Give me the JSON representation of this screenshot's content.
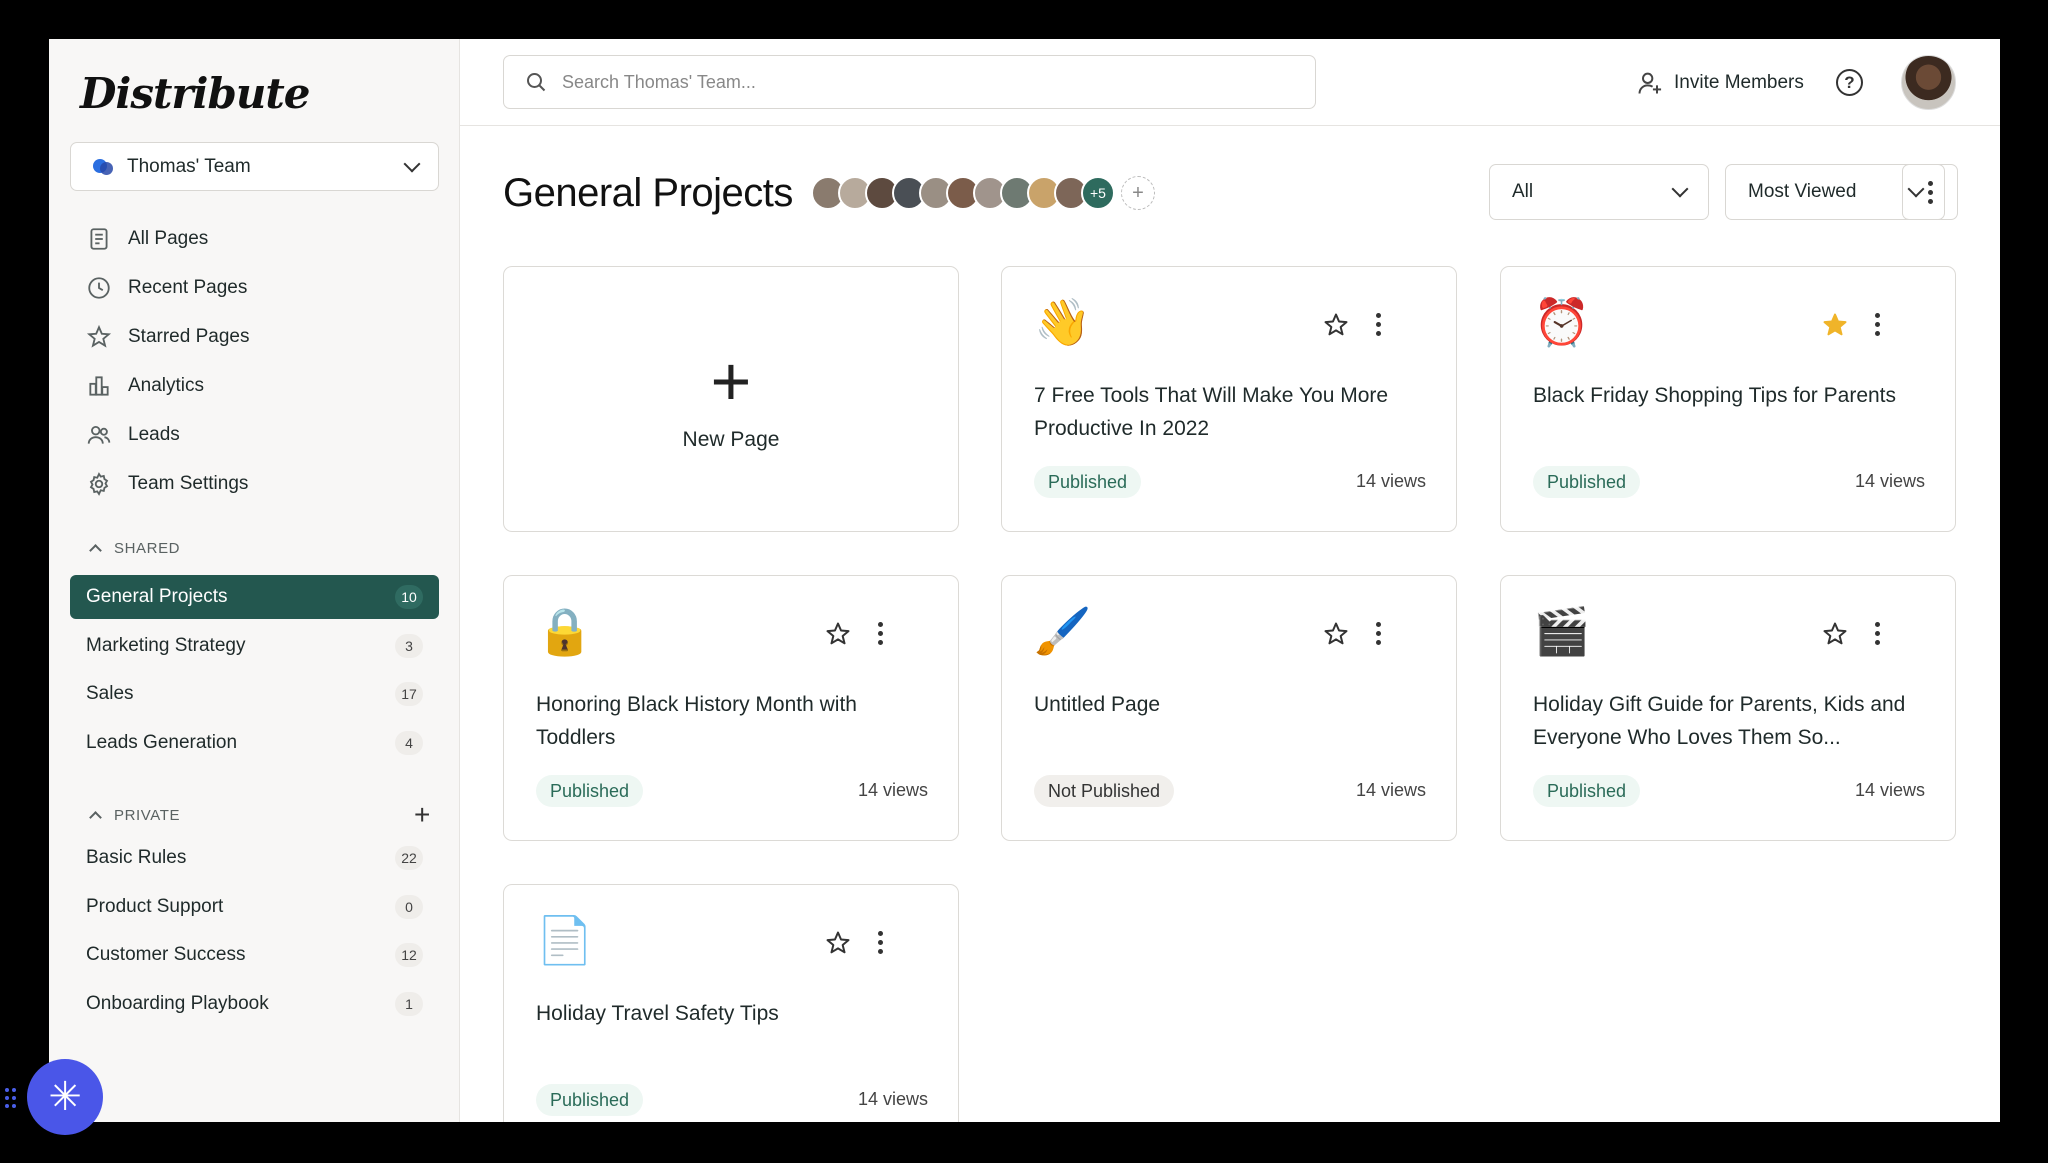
{
  "app": {
    "logo": "Distribute",
    "team": "Thomas' Team"
  },
  "nav": [
    {
      "label": "All Pages",
      "icon": "page-icon"
    },
    {
      "label": "Recent Pages",
      "icon": "clock-icon"
    },
    {
      "label": "Starred Pages",
      "icon": "star-icon"
    },
    {
      "label": "Analytics",
      "icon": "bar-chart-icon"
    },
    {
      "label": "Leads",
      "icon": "users-icon"
    },
    {
      "label": "Team Settings",
      "icon": "gear-icon"
    }
  ],
  "shared": {
    "heading": "SHARED",
    "items": [
      {
        "label": "General Projects",
        "count": "10"
      },
      {
        "label": "Marketing Strategy",
        "count": "3"
      },
      {
        "label": "Sales",
        "count": "17"
      },
      {
        "label": "Leads Generation",
        "count": "4"
      }
    ]
  },
  "private": {
    "heading": "PRIVATE",
    "items": [
      {
        "label": "Basic Rules",
        "count": "22"
      },
      {
        "label": "Product Support",
        "count": "0"
      },
      {
        "label": "Customer Success",
        "count": "12"
      },
      {
        "label": "Onboarding Playbook",
        "count": "1"
      }
    ]
  },
  "topbar": {
    "search_placeholder": "Search Thomas' Team...",
    "invite_label": "Invite Members",
    "help_glyph": "?"
  },
  "header": {
    "title": "General Projects",
    "more_members": "+5",
    "add_member": "+",
    "filter_value": "All",
    "sort_value": "Most Viewed"
  },
  "colors": {
    "accent": "#23574f",
    "star_filled": "#f0b429",
    "fab": "#4a56e8"
  },
  "new_page": {
    "plus": "+",
    "label": "New Page"
  },
  "cards": [
    {
      "emoji": "👋",
      "title": "7 Free Tools That Will Make You More Productive In 2022",
      "status": "Published",
      "views": "14 views",
      "starred": false
    },
    {
      "emoji": "⏰",
      "title": "Black Friday Shopping Tips for Parents",
      "status": "Published",
      "views": "14 views",
      "starred": true
    },
    {
      "emoji": "🔒",
      "title": "Honoring Black History Month with Toddlers",
      "status": "Published",
      "views": "14 views",
      "starred": false
    },
    {
      "emoji": "🖌️",
      "title": "Untitled Page",
      "status": "Not Published",
      "views": "14 views",
      "starred": false
    },
    {
      "emoji": "🎬",
      "title": "Holiday Gift Guide for Parents, Kids and Everyone Who Loves Them So...",
      "status": "Published",
      "views": "14 views",
      "starred": false
    },
    {
      "emoji": "📄",
      "title": "Holiday Travel Safety Tips",
      "status": "Published",
      "views": "14 views",
      "starred": false
    }
  ],
  "fab": {
    "glyph": "✳"
  }
}
